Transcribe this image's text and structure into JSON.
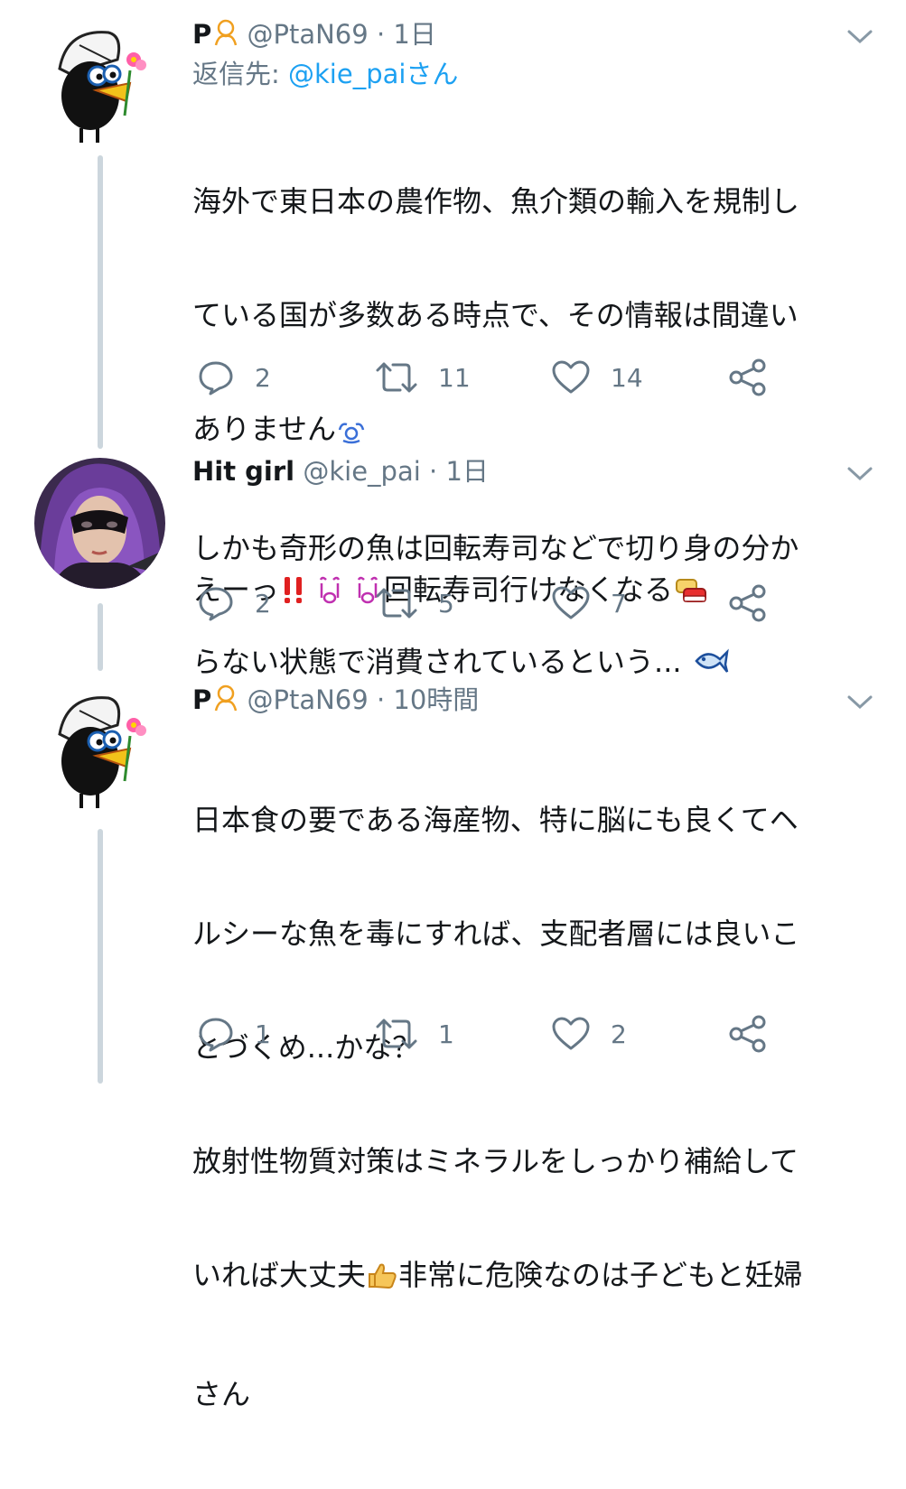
{
  "colors": {
    "muted": "#657786",
    "link": "#1da1f2",
    "line": "#ccd6dd"
  },
  "tweets": [
    {
      "name": "P",
      "name_emoji": "face-emoji",
      "handle": "@PtaN69",
      "dot": "·",
      "time": "1日",
      "reply_to_label": "返信先: ",
      "reply_to_handle": "@kie_paiさん",
      "lines": [
        "海外で東日本の農作物、魚介類の輸入を規制し",
        "ている国が多数ある時点で、その情報は間違い",
        "ありません",
        "しかも奇形の魚は回転寿司などで切り身の分か",
        "らない状態で消費されているという..."
      ],
      "emojis": [
        "sweat-emoji",
        "fish-emoji"
      ],
      "replies": "2",
      "retweets": "11",
      "likes": "14"
    },
    {
      "name": "Hit girl",
      "handle": "@kie_pai",
      "dot": "·",
      "time": "1日",
      "text_before": "えーっ",
      "text_after": "回転寿司行けなくなる",
      "emojis": [
        "exclamation-emoji",
        "crying-face-emoji",
        "crying-face-emoji",
        "sushi-emoji"
      ],
      "replies": "2",
      "retweets": "5",
      "likes": "7"
    },
    {
      "name": "P",
      "name_emoji": "face-emoji",
      "handle": "@PtaN69",
      "dot": "·",
      "time": "10時間",
      "lines": [
        "日本食の要である海産物、特に脳にも良くてヘ",
        "ルシーな魚を毒にすれば、支配者層には良いこ",
        "とづくめ...かな？",
        "放射性物質対策はミネラルをしっかり補給して",
        "いれば大丈夫",
        "非常に危険なのは子どもと妊婦",
        "さん"
      ],
      "emojis": [
        "thumbs-up-emoji"
      ],
      "replies": "1",
      "retweets": "1",
      "likes": "2"
    }
  ]
}
